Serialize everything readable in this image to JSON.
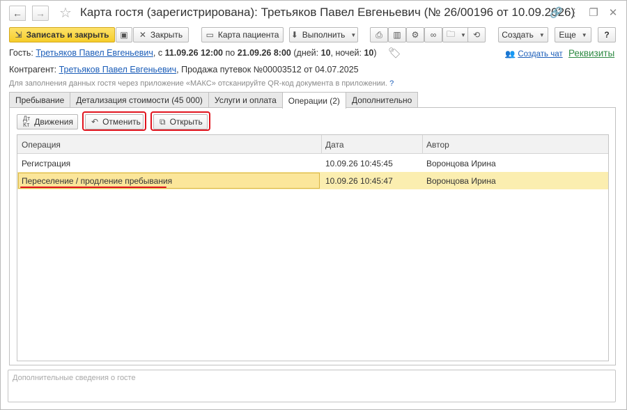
{
  "window": {
    "title": "Карта гостя (зарегистрирована): Третьяков Павел Евгеньевич (№ 26/00196 от 10.09.2026)"
  },
  "toolbar": {
    "save_close": "Записать и закрыть",
    "close": "Закрыть",
    "patient_card": "Карта пациента",
    "execute": "Выполнить",
    "create": "Создать",
    "more": "Еще",
    "help": "?"
  },
  "guest": {
    "label": "Гость:",
    "name": "Третьяков Павел Евгеньевич",
    "from_label": ", с",
    "from": "11.09.26 12:00",
    "to_label": "по",
    "to": "21.09.26 8:00",
    "days_label": "(дней:",
    "days": "10",
    "nights_label": ", ночей:",
    "nights": "10",
    "close_paren": ")"
  },
  "contractor": {
    "label": "Контрагент:",
    "name": "Третьяков Павел Евгеньевич",
    "rest": ", Продажа путевок №00003512 от 04.07.2025"
  },
  "hint": {
    "text": "Для заполнения данных гостя через приложение «МАКС» отсканируйте QR-код документа в приложении.",
    "q": "?"
  },
  "links": {
    "create_chat": "Создать чат",
    "requisites": "Реквизиты"
  },
  "tabs": [
    {
      "label": "Пребывание"
    },
    {
      "label": "Детализация стоимости (45 000)"
    },
    {
      "label": "Услуги и оплата"
    },
    {
      "label": "Операции (2)"
    },
    {
      "label": "Дополнительно"
    }
  ],
  "operations": {
    "movements_button": "Движения",
    "cancel_button": "Отменить",
    "open_button": "Открыть",
    "columns": [
      "Операция",
      "Дата",
      "Автор"
    ],
    "rows": [
      {
        "operation": "Регистрация",
        "date": "10.09.26 10:45:45",
        "author": "Воронцова Ирина"
      },
      {
        "operation": "Переселение / продление пребывания",
        "date": "10.09.26 10:45:47",
        "author": "Воронцова Ирина"
      }
    ],
    "selected_row": 2
  },
  "notes": {
    "placeholder": "Дополнительные сведения о госте"
  },
  "colors": {
    "primary_button": "#f6cd2a",
    "link": "#1b5db8",
    "highlight_red": "#e0141e",
    "selected_row": "#fbeeb0",
    "requisites": "#2d8a43"
  }
}
